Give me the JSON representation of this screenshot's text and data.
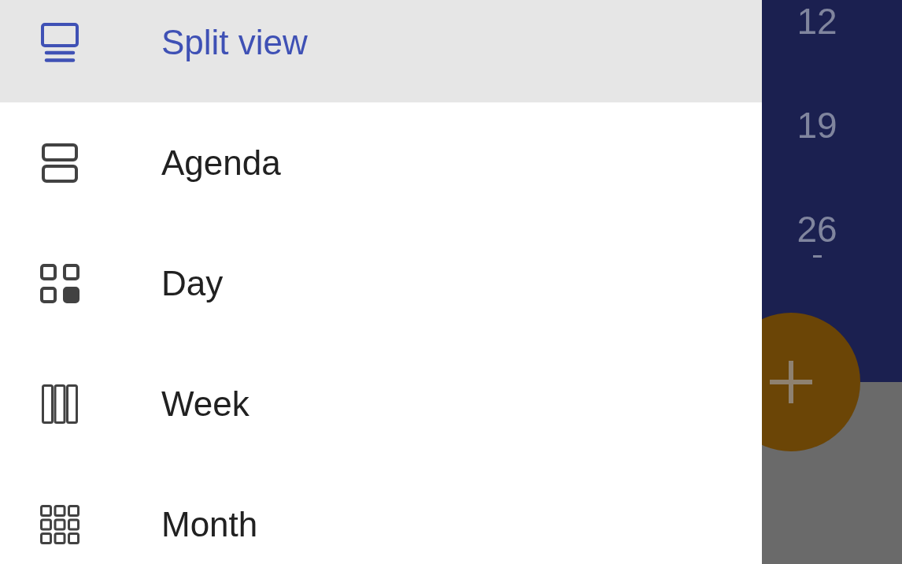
{
  "drawer": {
    "items": [
      {
        "label": "Split view",
        "kind": "split",
        "selected": true
      },
      {
        "label": "Agenda",
        "kind": "agenda",
        "selected": false
      },
      {
        "label": "Day",
        "kind": "day",
        "selected": false
      },
      {
        "label": "Week",
        "kind": "week",
        "selected": false
      },
      {
        "label": "Month",
        "kind": "month",
        "selected": false
      }
    ]
  },
  "calendar": {
    "dates": [
      {
        "label": "12",
        "has_events": false
      },
      {
        "label": "19",
        "has_events": false
      },
      {
        "label": "26",
        "has_events": true
      }
    ]
  }
}
